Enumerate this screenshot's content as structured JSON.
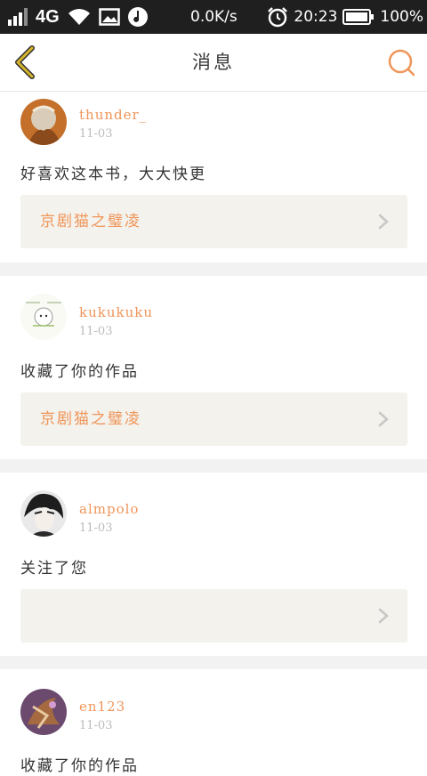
{
  "status_bar": {
    "network": "4G",
    "speed": "0.0K/s",
    "time": "20:23",
    "battery": "100%"
  },
  "header": {
    "title": "消息"
  },
  "colors": {
    "accent": "#f0955a",
    "back_icon": "#c9a41f",
    "link_bg": "#f3f2ec",
    "divider": "#f2f2f2"
  },
  "messages": [
    {
      "username": "thunder_",
      "date": "11-03",
      "text": "好喜欢这本书，大大快更",
      "book_title": "京剧猫之璧凌",
      "avatar_icon": "avatar-thunder"
    },
    {
      "username": "kukukuku",
      "date": "11-03",
      "text": "收藏了你的作品",
      "book_title": "京剧猫之璧凌",
      "avatar_icon": "avatar-kukukuku"
    },
    {
      "username": "almpolo",
      "date": "11-03",
      "text": "关注了您",
      "book_title": "",
      "avatar_icon": "avatar-almpolo"
    },
    {
      "username": "en123",
      "date": "11-03",
      "text": "收藏了你的作品",
      "avatar_icon": "avatar-en123"
    }
  ]
}
